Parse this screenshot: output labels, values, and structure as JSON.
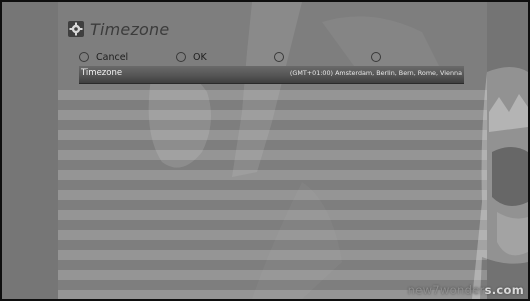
{
  "window": {
    "title": "Timezone",
    "icon": "gear-icon"
  },
  "color_buttons": [
    {
      "label": "Cancel",
      "icon": "circle-button-icon"
    },
    {
      "label": "OK",
      "icon": "circle-button-icon"
    },
    {
      "label": "",
      "icon": "circle-button-icon"
    },
    {
      "label": "",
      "icon": "circle-button-icon"
    }
  ],
  "settings": {
    "timezone_row": {
      "label": "Timezone",
      "value": "(GMT+01:00) Amsterdam, Berlin, Bern, Rome, Vienna"
    }
  },
  "watermark": {
    "prefix": "new7wonder",
    "suffix": "s.com"
  },
  "colors": {
    "frame": "#0e0e0e",
    "panel": "#6e6e6e",
    "stripe": "#9a9a9a",
    "selected_row": "#4e4e4e"
  }
}
